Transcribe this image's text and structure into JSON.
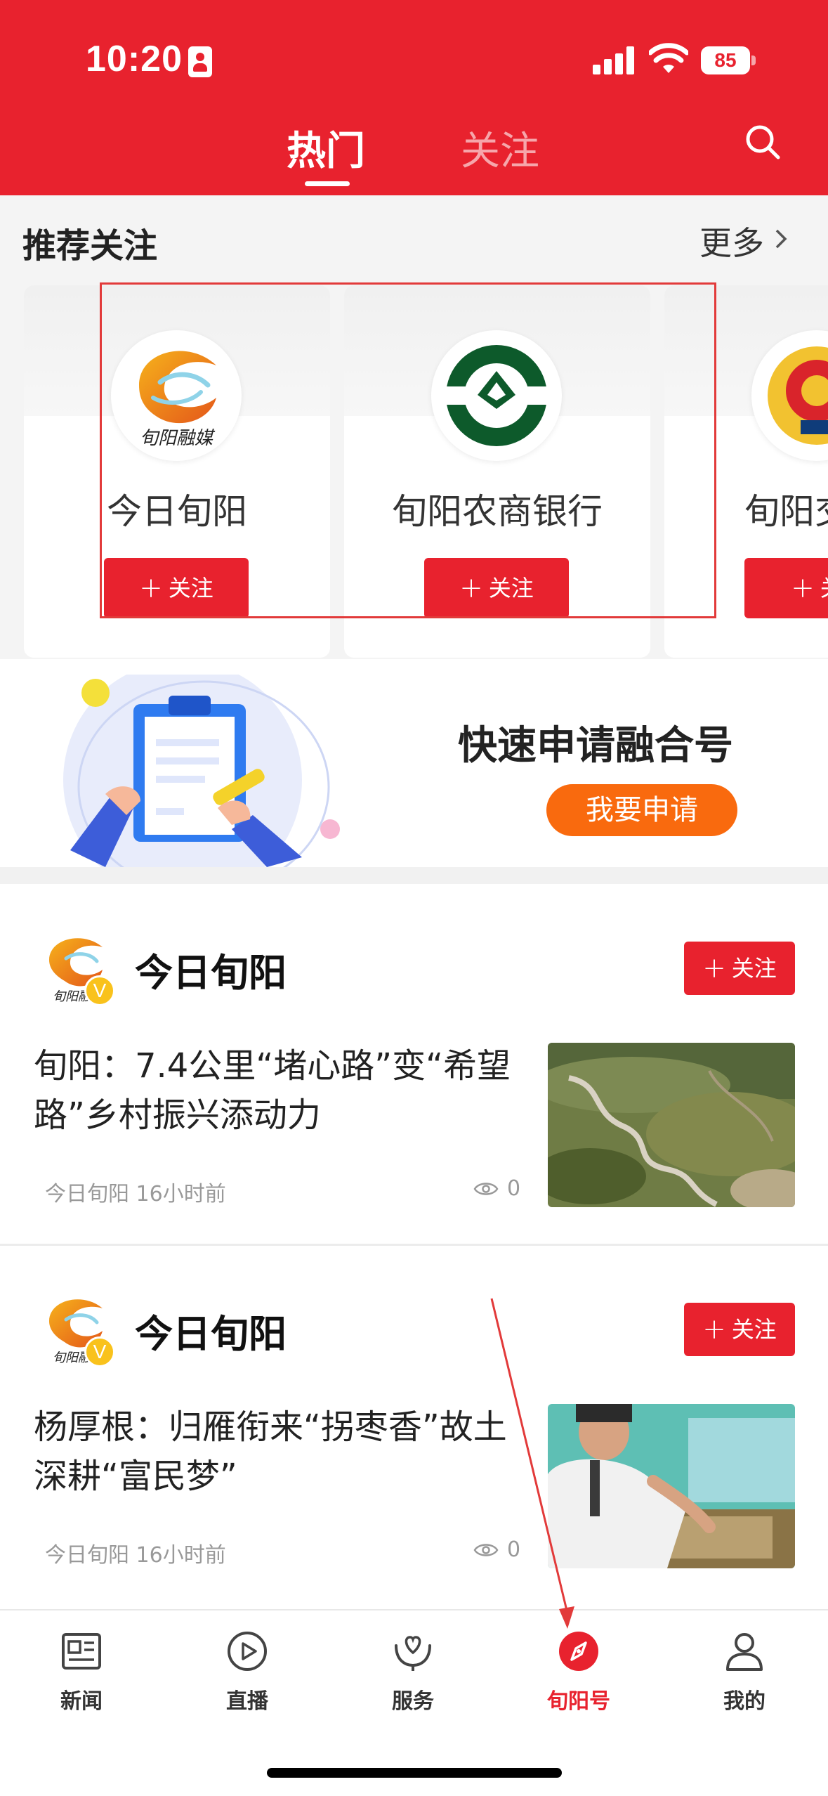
{
  "status_bar": {
    "time": "10:20",
    "battery": "85"
  },
  "header": {
    "tabs": [
      "热门",
      "关注"
    ],
    "active_tab": "热门"
  },
  "recommend": {
    "title": "推荐关注",
    "more": "更多",
    "cards": [
      {
        "name": "今日旬阳",
        "logo_caption": "旬阳融媒",
        "follow": "关注"
      },
      {
        "name": "旬阳农商银行",
        "follow": "关注"
      },
      {
        "name": "旬阳交",
        "follow": "关"
      }
    ]
  },
  "banner": {
    "title": "快速申请融合号",
    "button": "我要申请"
  },
  "feed": [
    {
      "author": "今日旬阳",
      "avatar_caption": "旬阳融",
      "badge": "V",
      "follow": "关注",
      "title": "旬阳：7.4公里“堵心路”变“希望路”乡村振兴添动力",
      "meta": "今日旬阳 16小时前",
      "views": "0"
    },
    {
      "author": "今日旬阳",
      "avatar_caption": "旬阳融",
      "badge": "V",
      "follow": "关注",
      "title": "杨厚根：归雁衔来“拐枣香”故土深耕“富民梦”",
      "meta": "今日旬阳 16小时前",
      "views": "0"
    }
  ],
  "tabbar": [
    {
      "label": "新闻",
      "icon": "newspaper-icon"
    },
    {
      "label": "直播",
      "icon": "play-icon"
    },
    {
      "label": "服务",
      "icon": "service-heart-icon"
    },
    {
      "label": "旬阳号",
      "icon": "compass-icon",
      "active": true
    },
    {
      "label": "我的",
      "icon": "person-icon"
    }
  ],
  "colors": {
    "brand_red": "#e8222e",
    "orange": "#f96a0e",
    "annotation_red": "#e23a3a"
  }
}
